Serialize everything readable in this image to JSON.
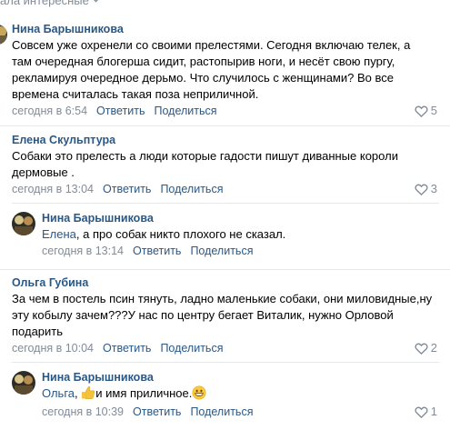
{
  "header": {
    "partial_text": "ала интересные"
  },
  "comments": [
    {
      "author": "Нина Барышникова",
      "text": "Совсем уже охренели со своими прелестями. Сегодня включаю телек, а там очередная блогерша сидит, растопырив ноги, и несёт свою пургу, рекламируя очередное дерьмо. Что случилось с женщинами? Во все времена считалась такая поза неприличной.",
      "time": "сегодня в 6:54",
      "reply_label": "Ответить",
      "share_label": "Поделиться",
      "likes": "5"
    },
    {
      "author": "Елена Скульптура",
      "text": "Собаки это прелесть а люди которые гадости пишут диванные короли дермовые .",
      "time": "сегодня в 13:04",
      "reply_label": "Ответить",
      "share_label": "Поделиться",
      "likes": "3"
    },
    {
      "author": "Нина Барышникова",
      "mention": "Елена",
      "text": ", а про собак никто плохого не сказал.",
      "time": "сегодня в 13:14",
      "reply_label": "Ответить",
      "share_label": "Поделиться",
      "likes": ""
    },
    {
      "author": "Ольга Губина",
      "text": "За чем в постель псин тянуть, ладно маленькие собаки, они миловидные,ну эту кобылу зачем???У нас по центру бегает Виталик, нужно Орловой подарить",
      "time": "сегодня в 10:04",
      "reply_label": "Ответить",
      "share_label": "Поделиться",
      "likes": "2"
    },
    {
      "author": "Нина Барышникова",
      "mention": "Ольга",
      "text_before_emoji": ", ",
      "text_after_emoji": "и имя приличное.",
      "time": "сегодня в 10:39",
      "reply_label": "Ответить",
      "share_label": "Поделиться",
      "likes": "1"
    }
  ],
  "icons": {
    "like": "heart-outline-icon",
    "thumbs_up": "thumbs-up-emoji",
    "grin": "grinning-emoji",
    "chevron": "chevron-down-icon"
  },
  "colors": {
    "link": "#2a5885",
    "muted": "#818c99",
    "separator": "#e7e8ec"
  }
}
